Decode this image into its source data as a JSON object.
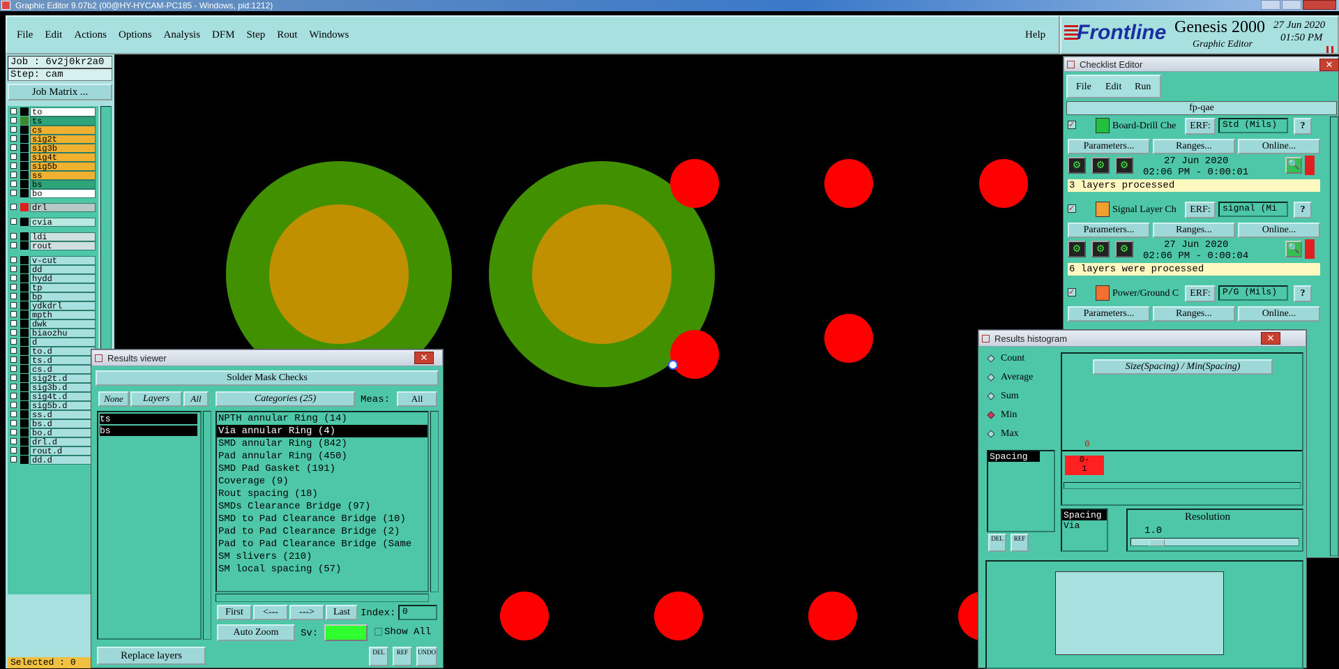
{
  "window_title": "Graphic Editor 9.07b2 (00@HY-HYCAM-PC185 - Windows, pid:1212)",
  "menu": [
    "File",
    "Edit",
    "Actions",
    "Options",
    "Analysis",
    "DFM",
    "Step",
    "Rout",
    "Windows"
  ],
  "help": "Help",
  "brand": {
    "logo": "Frontline",
    "product": "Genesis 2000",
    "subtitle": "Graphic Editor",
    "date": "27 Jun 2020",
    "time": "01:50 PM"
  },
  "job": {
    "job": "Job : 6v2j0kr2a0",
    "step": "Step: cam",
    "matrix_btn": "Job Matrix ..."
  },
  "layers_group1": [
    {
      "name": "to",
      "color": "#ffffff"
    },
    {
      "name": "ts",
      "color": "#2fa37a",
      "swatch": "#3d8a2e"
    },
    {
      "name": "cs",
      "color": "#f0b030"
    },
    {
      "name": "sig2t",
      "color": "#f0b030"
    },
    {
      "name": "sig3b",
      "color": "#f0b030"
    },
    {
      "name": "sig4t",
      "color": "#f0b030"
    },
    {
      "name": "sig5b",
      "color": "#f0b030"
    },
    {
      "name": "ss",
      "color": "#f0b030"
    },
    {
      "name": "bs",
      "color": "#2fa37a"
    },
    {
      "name": "bo",
      "color": "#ffffff"
    }
  ],
  "layers_group2": [
    {
      "name": "drl",
      "color": "#b8c8c8",
      "swatch": "#e02020"
    }
  ],
  "layers_group3": [
    {
      "name": "cvia",
      "color": "#b8e8e0"
    }
  ],
  "layers_group4": [
    {
      "name": "ldi",
      "color": "#d0e0e0"
    },
    {
      "name": "rout",
      "color": "#d0e0e0"
    }
  ],
  "layers_group5": [
    "v-cut",
    "dd",
    "hydd",
    "tp",
    "bp",
    "ydkdrl",
    "mpth",
    "dwk",
    "biaozhu",
    "d",
    "to.d",
    "ts.d",
    "cs.d",
    "sig2t.d",
    "sig3b.d",
    "sig4t.d",
    "sig5b.d",
    "ss.d",
    "bs.d",
    "bo.d",
    "drl.d",
    "rout.d",
    "dd.d"
  ],
  "selected": "Selected : 0",
  "results_viewer": {
    "title": "Results viewer",
    "header": "Solder Mask Checks",
    "none": "None",
    "layers": "Layers",
    "all": "All",
    "categories": "Categories (25)",
    "meas_label": "Meas:",
    "meas_value": "All",
    "layer_list": [
      "ts",
      "bs"
    ],
    "category_list": [
      "NPTH annular Ring (14)",
      "Via annular Ring (4)",
      "SMD annular Ring (842)",
      "Pad annular Ring (450)",
      "SMD Pad Gasket (191)",
      "Coverage (9)",
      "Rout spacing (18)",
      "SMDs Clearance Bridge (97)",
      "SMD to Pad Clearance Bridge (10)",
      "Pad to Pad Clearance Bridge (2)",
      "Pad to Pad Clearance Bridge (Same",
      "SM slivers (210)",
      "SM local spacing (57)"
    ],
    "first": "First",
    "prev": "<---",
    "next": "--->",
    "last": "Last",
    "index_label": "Index:",
    "index_value": "0",
    "zoom": "Auto Zoom",
    "sv": "Sv:",
    "show_all": "Show All",
    "replace": "Replace layers",
    "del": "DEL",
    "ref": "REF",
    "undo": "UNDO"
  },
  "checklist": {
    "title": "Checklist Editor",
    "menu": [
      "File",
      "Edit",
      "Run"
    ],
    "name": "fp-qae",
    "erf": "ERF:",
    "params": "Parameters...",
    "ranges": "Ranges...",
    "online": "Online...",
    "items": [
      {
        "name": "Board-Drill Che",
        "erf": "Std (Mils)",
        "date": "27 Jun 2020",
        "time": "02:06 PM - 0:00:01",
        "status": "3 layers processed"
      },
      {
        "name": "Signal Layer Ch",
        "erf": "signal (Mi",
        "date": "27 Jun 2020",
        "time": "02:06 PM - 0:00:04",
        "status": "6 layers were processed"
      },
      {
        "name": "Power/Ground C",
        "erf": "P/G (Mils)"
      }
    ]
  },
  "histogram": {
    "title": "Results histogram",
    "stats": [
      "Count",
      "Average",
      "Sum",
      "Min",
      "Max"
    ],
    "selected": "Min",
    "formula": "Size(Spacing) / Min(Spacing)",
    "axis_zero": "0",
    "bin_label": "0-\n1",
    "list1": [
      "Spacing"
    ],
    "list2": [
      "Spacing",
      "Via"
    ],
    "resolution": "Resolution",
    "res_value": "1.0",
    "del": "DEL",
    "ref": "REF"
  },
  "colors": {
    "panel": "#4ec7a9",
    "button": "#9fd8d8",
    "menubar": "#a8e0e0",
    "copper": "#c09000",
    "mask": "#409000",
    "drill": "#ff0000"
  }
}
